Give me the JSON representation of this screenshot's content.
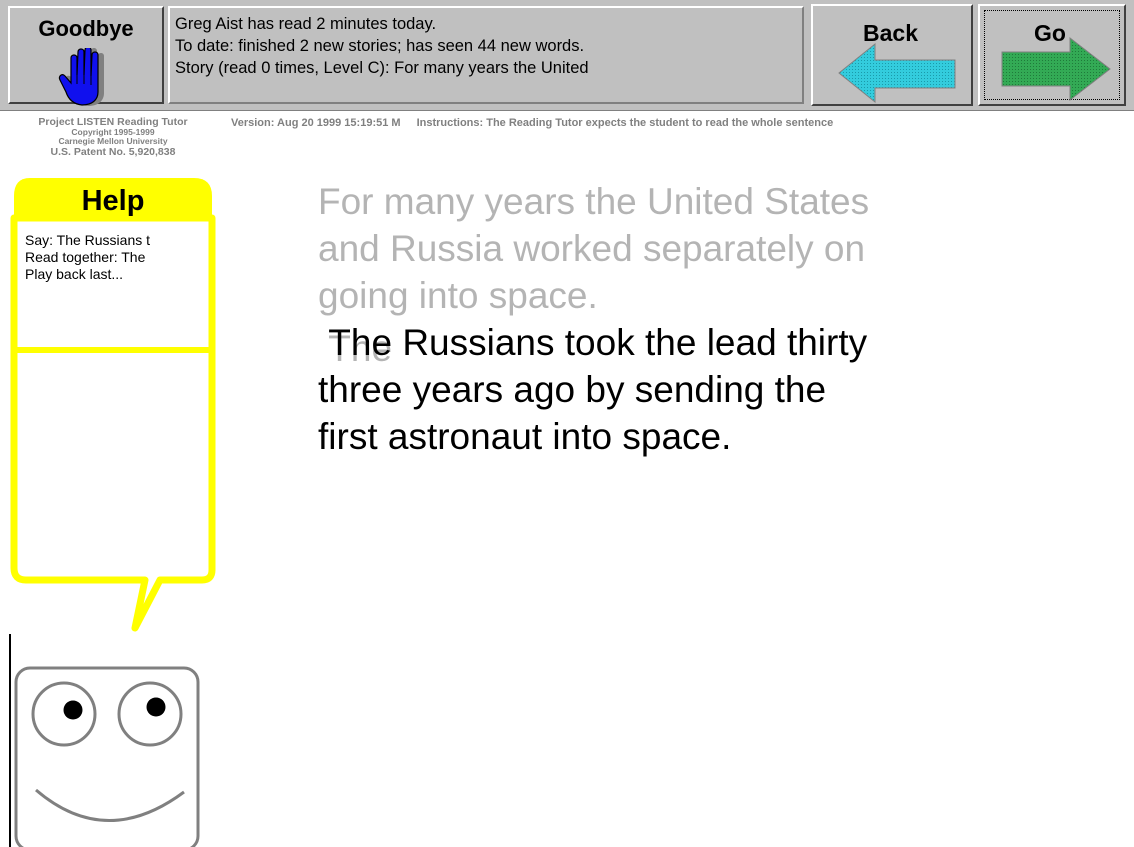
{
  "goodbye": {
    "label": "Goodbye",
    "icon": "hand-stop-icon"
  },
  "status": {
    "line1": "Greg Aist has read 2 minutes today.",
    "line2": "To date:  finished 2 new stories; has seen 44 new words.",
    "line3": "Story (read 0 times, Level C): For many years the United"
  },
  "nav": {
    "back_label": "Back",
    "go_label": "Go",
    "back_color": "#33ccdd",
    "go_color": "#33aa55"
  },
  "credits": {
    "name": "Project LISTEN Reading Tutor",
    "copyright": "Copyright 1995-1999",
    "org": "Carnegie Mellon University",
    "patent": "U.S. Patent No. 5,920,838"
  },
  "info": {
    "version": "Version: Aug 20 1999 15:19:51 M",
    "instructions": "Instructions: The Reading Tutor expects the student to read the whole sentence"
  },
  "help": {
    "title": "Help",
    "accent": "#ffff00",
    "items": [
      "Say: The Russians t",
      "Read together: The",
      "Play back last..."
    ]
  },
  "story": {
    "previous_lines": [
      "For many years the United States",
      "and Russia worked separately on",
      "going into space."
    ],
    "current_first_word": "The",
    "current_line1_rest": " Russians took the lead thirty",
    "current_lines": [
      "three years ago by sending the",
      "first astronaut into space."
    ]
  }
}
